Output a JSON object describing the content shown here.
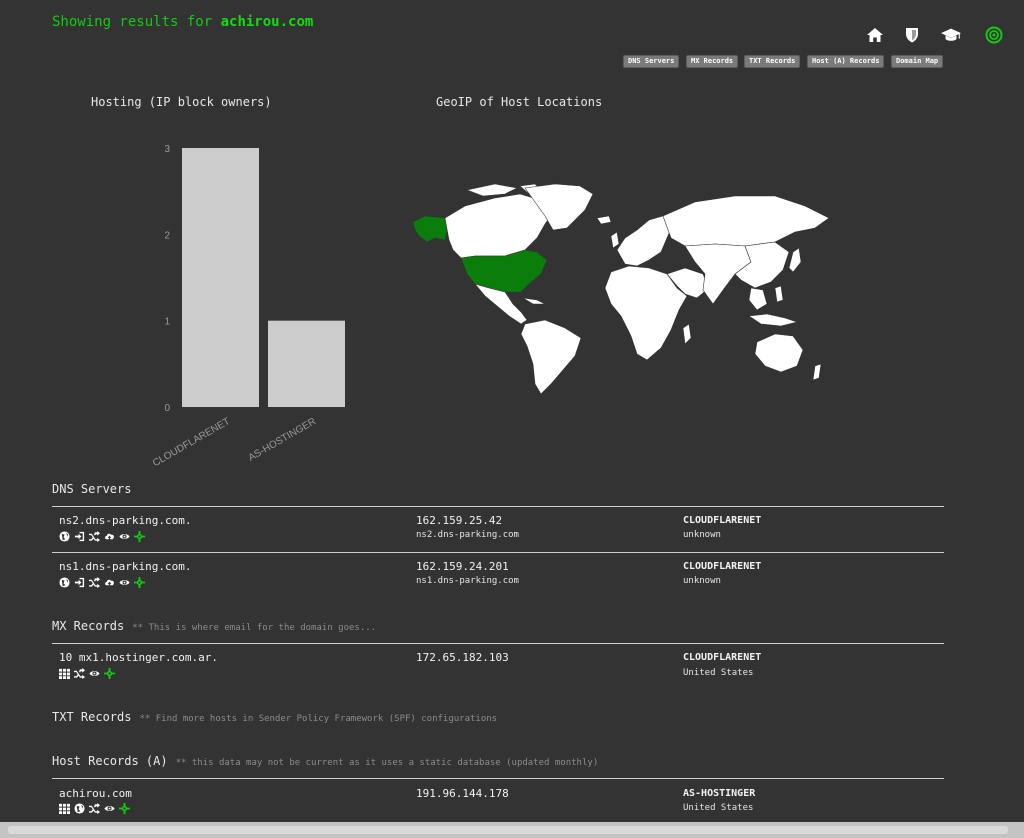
{
  "header": {
    "prefix": "Showing results for",
    "domain": "achirou.com"
  },
  "nav_icons": [
    "home-icon",
    "shield-icon",
    "graduation-cap-icon",
    "target-icon"
  ],
  "tags": [
    "DNS Servers",
    "MX Records",
    "TXT Records",
    "Host (A) Records",
    "Domain Map"
  ],
  "charts": {
    "hosting_title": "Hosting (IP block owners)",
    "geoip_title": "GeoIP of Host Locations"
  },
  "chart_data": {
    "type": "bar",
    "title": "Hosting (IP block owners)",
    "categories": [
      "CLOUDFLARENET",
      "AS-HOSTINGER"
    ],
    "values": [
      3,
      1
    ],
    "ylim": [
      0,
      3
    ],
    "yticks": [
      "0",
      "1",
      "2",
      "3"
    ],
    "grid": false
  },
  "map": {
    "highlighted_country": "United States",
    "highlight_color": "#0a7d0a",
    "land_color": "#ffffff"
  },
  "sections": {
    "dns": {
      "title": "DNS Servers"
    },
    "mx": {
      "title": "MX Records",
      "note": "** This is where email for the domain goes..."
    },
    "txt": {
      "title": "TXT Records",
      "note": "** Find more hosts in Sender Policy Framework (SPF) configurations"
    },
    "host": {
      "title": "Host Records (A)",
      "note": "** this data may not be current as it uses a static database (updated monthly)"
    }
  },
  "dns_rows": [
    {
      "host": "ns2.dns-parking.com.",
      "ip": "162.159.25.42",
      "ptr": "ns2.dns-parking.com",
      "owner": "CLOUDFLARENET",
      "country": "unknown"
    },
    {
      "host": "ns1.dns-parking.com.",
      "ip": "162.159.24.201",
      "ptr": "ns1.dns-parking.com",
      "owner": "CLOUDFLARENET",
      "country": "unknown"
    }
  ],
  "mx_rows": [
    {
      "host": "10 mx1.hostinger.com.ar.",
      "ip": "172.65.182.103",
      "owner": "CLOUDFLARENET",
      "country": "United States"
    }
  ],
  "host_rows": [
    {
      "host": "achirou.com",
      "ip": "191.96.144.178",
      "owner": "AS-HOSTINGER",
      "country": "United States"
    }
  ],
  "colors": {
    "background": "#333333",
    "accent_green": "#11cc11",
    "bar_fill": "#cccccc",
    "tag_bg": "#7a7a7a"
  }
}
